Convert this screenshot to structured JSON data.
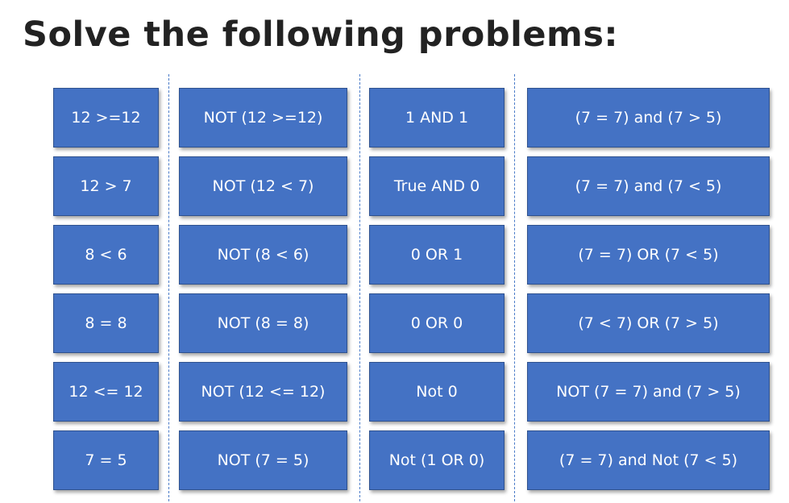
{
  "title": "Solve the following problems:",
  "colors": {
    "cell_fill": "#4472c4",
    "cell_border": "#2f528f",
    "divider": "#4a7bc8",
    "title_text": "#222222"
  },
  "columns": [
    {
      "cells": [
        "12 >=12",
        "12 > 7",
        "8 < 6",
        "8 = 8",
        "12 <= 12",
        "7 = 5"
      ]
    },
    {
      "cells": [
        "NOT (12 >=12)",
        "NOT (12 < 7)",
        "NOT (8 < 6)",
        "NOT (8 = 8)",
        "NOT (12 <= 12)",
        "NOT (7 = 5)"
      ]
    },
    {
      "cells": [
        "1 AND 1",
        "True AND 0",
        "0 OR 1",
        "0 OR 0",
        "Not 0",
        "Not (1 OR 0)"
      ]
    },
    {
      "cells": [
        "(7 = 7) and (7 > 5)",
        "(7 = 7) and (7 < 5)",
        "(7 = 7) OR (7 < 5)",
        "(7 < 7) OR (7 > 5)",
        "NOT (7 = 7) and (7 > 5)",
        "(7 = 7) and Not (7 < 5)"
      ]
    }
  ]
}
